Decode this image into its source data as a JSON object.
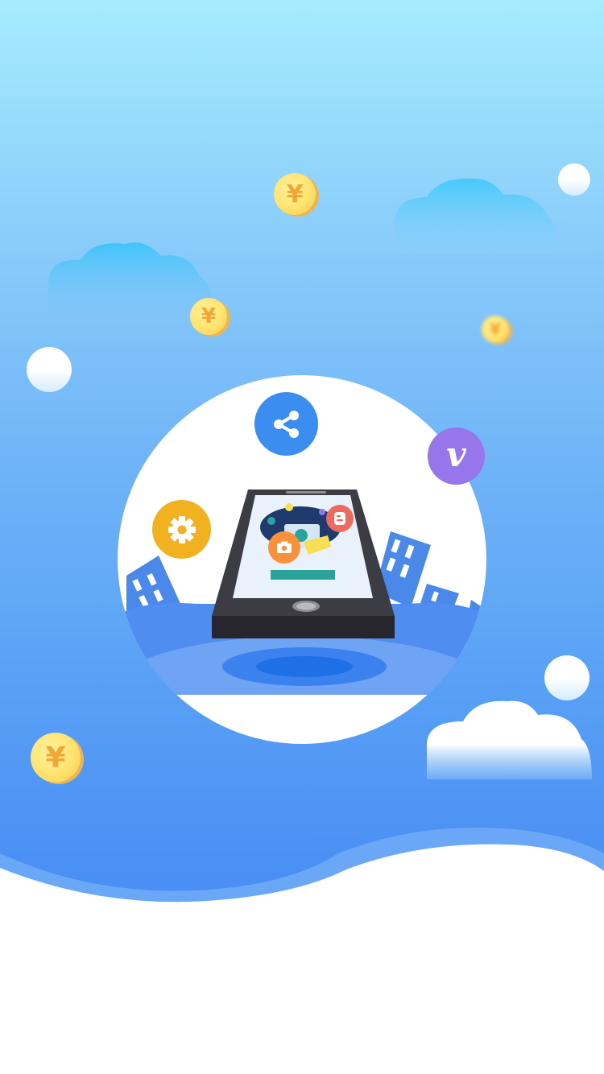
{
  "currency_symbol": "¥",
  "vimeo_letter": "v",
  "colors": {
    "sky_top": "#a6ecfe",
    "sky_bottom": "#4488f2",
    "coin": "#ffe36f",
    "share_icon_bg": "#3b8ef0",
    "vimeo_icon_bg": "#9676ea",
    "settings_icon_bg": "#f2b21f",
    "camera_icon_bg": "#f7923a",
    "blogger_icon_bg": "#ef6a5e"
  },
  "icons": [
    "share-icon",
    "vimeo-icon",
    "settings-gear-icon",
    "camera-icon",
    "blogger-icon"
  ]
}
